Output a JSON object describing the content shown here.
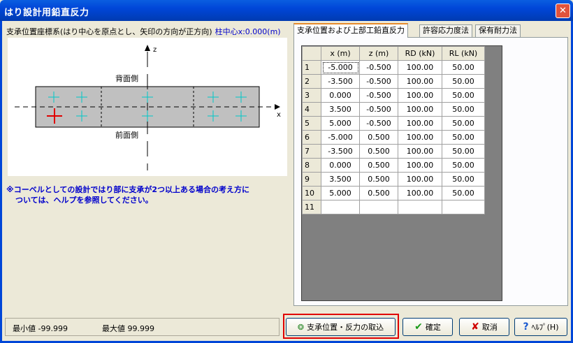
{
  "window": {
    "title": "はり設計用鉛直反力",
    "close_glyph": "✕"
  },
  "left": {
    "coord_label": "支承位置座標系(はり中心を原点とし、矢印の方向が正方向)",
    "column_center_label": "柱中心x:0.000(m)",
    "diagram": {
      "z_axis_label": "z",
      "x_axis_label": "x",
      "back_side_label": "背面側",
      "front_side_label": "前面側"
    },
    "note_line1": "※コーベルとしての設計ではり部に支承が2つ以上ある場合の考え方に",
    "note_line2": "ついては、ヘルプを参照してください。"
  },
  "tabs": [
    {
      "label": "支承位置および上部工鉛直反力",
      "active": true
    },
    {
      "label": "許容応力度法",
      "active": false
    },
    {
      "label": "保有耐力法",
      "active": false
    }
  ],
  "grid": {
    "headers": [
      "",
      "x (m)",
      "z (m)",
      "RD (kN)",
      "RL (kN)"
    ],
    "rows": [
      {
        "n": "1",
        "x": "-5.000",
        "z": "-0.500",
        "rd": "100.00",
        "rl": "50.00"
      },
      {
        "n": "2",
        "x": "-3.500",
        "z": "-0.500",
        "rd": "100.00",
        "rl": "50.00"
      },
      {
        "n": "3",
        "x": "0.000",
        "z": "-0.500",
        "rd": "100.00",
        "rl": "50.00"
      },
      {
        "n": "4",
        "x": "3.500",
        "z": "-0.500",
        "rd": "100.00",
        "rl": "50.00"
      },
      {
        "n": "5",
        "x": "5.000",
        "z": "-0.500",
        "rd": "100.00",
        "rl": "50.00"
      },
      {
        "n": "6",
        "x": "-5.000",
        "z": "0.500",
        "rd": "100.00",
        "rl": "50.00"
      },
      {
        "n": "7",
        "x": "-3.500",
        "z": "0.500",
        "rd": "100.00",
        "rl": "50.00"
      },
      {
        "n": "8",
        "x": "0.000",
        "z": "0.500",
        "rd": "100.00",
        "rl": "50.00"
      },
      {
        "n": "9",
        "x": "3.500",
        "z": "0.500",
        "rd": "100.00",
        "rl": "50.00"
      },
      {
        "n": "10",
        "x": "5.000",
        "z": "0.500",
        "rd": "100.00",
        "rl": "50.00"
      },
      {
        "n": "11",
        "x": "",
        "z": "",
        "rd": "",
        "rl": ""
      }
    ]
  },
  "status": {
    "min_label": "最小値 -99.999",
    "max_label": "最大値 99.999"
  },
  "buttons": {
    "import_label": "支承位置・反力の取込",
    "ok_label": "確定",
    "cancel_label": "取消",
    "help_label": "ﾍﾙﾌﾟ(H)"
  },
  "colors": {
    "titlebar": "#0046d8",
    "note_text": "#0000cc",
    "highlight_box": "#e00000",
    "cross_marker": "#00c8c8",
    "selected_marker": "#e00000"
  }
}
